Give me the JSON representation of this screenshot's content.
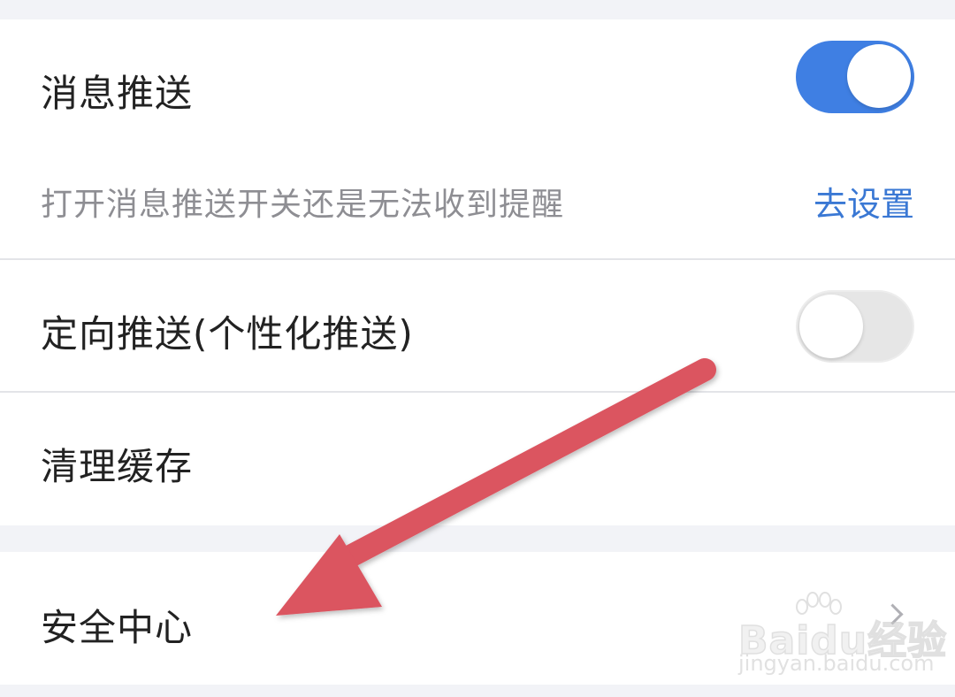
{
  "settings": {
    "push": {
      "label": "消息推送",
      "toggle_state": "on",
      "hint": "打开消息推送开关还是无法收到提醒",
      "hint_link": "去设置"
    },
    "targeted_push": {
      "label": "定向推送(个性化推送)",
      "toggle_state": "off"
    },
    "clear_cache": {
      "label": "清理缓存"
    },
    "security_center": {
      "label": "安全中心"
    }
  },
  "watermark": {
    "brand": "Baidu经验",
    "url": "jingyan.baidu.com"
  },
  "colors": {
    "toggle_on": "#3f7fe3",
    "link": "#3a78d4",
    "annotation_arrow": "#db5460",
    "background": "#f2f3f7"
  },
  "icons": {
    "annotation": "arrow-annotation-icon",
    "row_chevron": "chevron-right-icon",
    "watermark_logo": "paw-logo-icon"
  }
}
